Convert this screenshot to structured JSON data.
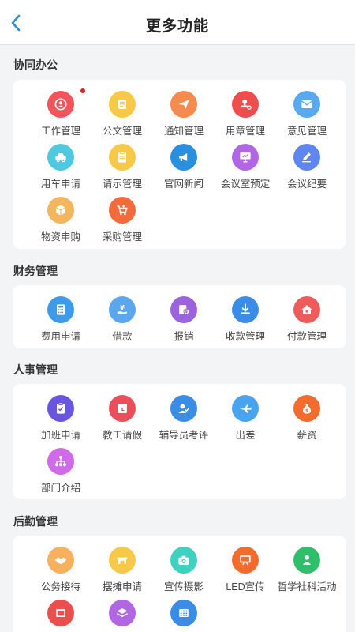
{
  "nav": {
    "title": "更多功能"
  },
  "sections": [
    {
      "title": "协同办公",
      "items": [
        {
          "label": "工作管理",
          "icon": "person-badge-icon",
          "color": "#f2545b",
          "dot": true
        },
        {
          "label": "公文管理",
          "icon": "document-icon",
          "color": "#f7c948"
        },
        {
          "label": "通知管理",
          "icon": "paper-plane-icon",
          "color": "#f58b4e"
        },
        {
          "label": "用章管理",
          "icon": "stamp-icon",
          "color": "#ec4d4d"
        },
        {
          "label": "意见管理",
          "icon": "envelope-icon",
          "color": "#5aa9ef"
        },
        {
          "label": "用车申请",
          "icon": "car-icon",
          "color": "#4fc9e0"
        },
        {
          "label": "请示管理",
          "icon": "clipboard-icon",
          "color": "#f7c948"
        },
        {
          "label": "官网新闻",
          "icon": "megaphone-icon",
          "color": "#2b8fe0"
        },
        {
          "label": "会议室预定",
          "icon": "presentation-icon",
          "color": "#b166e4"
        },
        {
          "label": "会议纪要",
          "icon": "pencil-note-icon",
          "color": "#5e86ee"
        },
        {
          "label": "物资申购",
          "icon": "box-icon",
          "color": "#f2b75e"
        },
        {
          "label": "采购管理",
          "icon": "cart-icon",
          "color": "#f36b3d"
        }
      ]
    },
    {
      "title": "财务管理",
      "items": [
        {
          "label": "费用申请",
          "icon": "calculator-icon",
          "color": "#3d9be9"
        },
        {
          "label": "借款",
          "icon": "yen-hand-icon",
          "color": "#5aa6ef"
        },
        {
          "label": "报销",
          "icon": "reimburse-icon",
          "color": "#9c63de"
        },
        {
          "label": "收款管理",
          "icon": "download-yen-icon",
          "color": "#3b8ce6"
        },
        {
          "label": "付款管理",
          "icon": "house-yen-icon",
          "color": "#ef5a5a"
        }
      ]
    },
    {
      "title": "人事管理",
      "items": [
        {
          "label": "加班申请",
          "icon": "checklist-icon",
          "color": "#6a55e0"
        },
        {
          "label": "教工请假",
          "icon": "leave-calendar-icon",
          "color": "#ec4d5a"
        },
        {
          "label": "辅导员考评",
          "icon": "user-check-icon",
          "color": "#3b8ce6"
        },
        {
          "label": "出差",
          "icon": "airplane-icon",
          "color": "#4aa3ee"
        },
        {
          "label": "薪资",
          "icon": "money-bag-icon",
          "color": "#f36b2d"
        },
        {
          "label": "部门介绍",
          "icon": "org-chart-icon",
          "color": "#d06be8"
        }
      ]
    },
    {
      "title": "后勤管理",
      "items": [
        {
          "label": "公务接待",
          "icon": "handshake-icon",
          "color": "#f7b15e"
        },
        {
          "label": "摆摊申请",
          "icon": "stall-icon",
          "color": "#f7c948"
        },
        {
          "label": "宣传摄影",
          "icon": "camera-icon",
          "color": "#3ed1c0"
        },
        {
          "label": "LED宣传",
          "icon": "led-screen-icon",
          "color": "#f36b2d"
        },
        {
          "label": "哲学社科活动",
          "icon": "person-speech-icon",
          "color": "#2fbf6b"
        },
        {
          "label": "",
          "icon": "window-icon",
          "color": "#ec4d4d"
        },
        {
          "label": "",
          "icon": "layers-icon",
          "color": "#b166e4"
        },
        {
          "label": "",
          "icon": "keypad-icon",
          "color": "#3b8ce6"
        }
      ]
    }
  ]
}
